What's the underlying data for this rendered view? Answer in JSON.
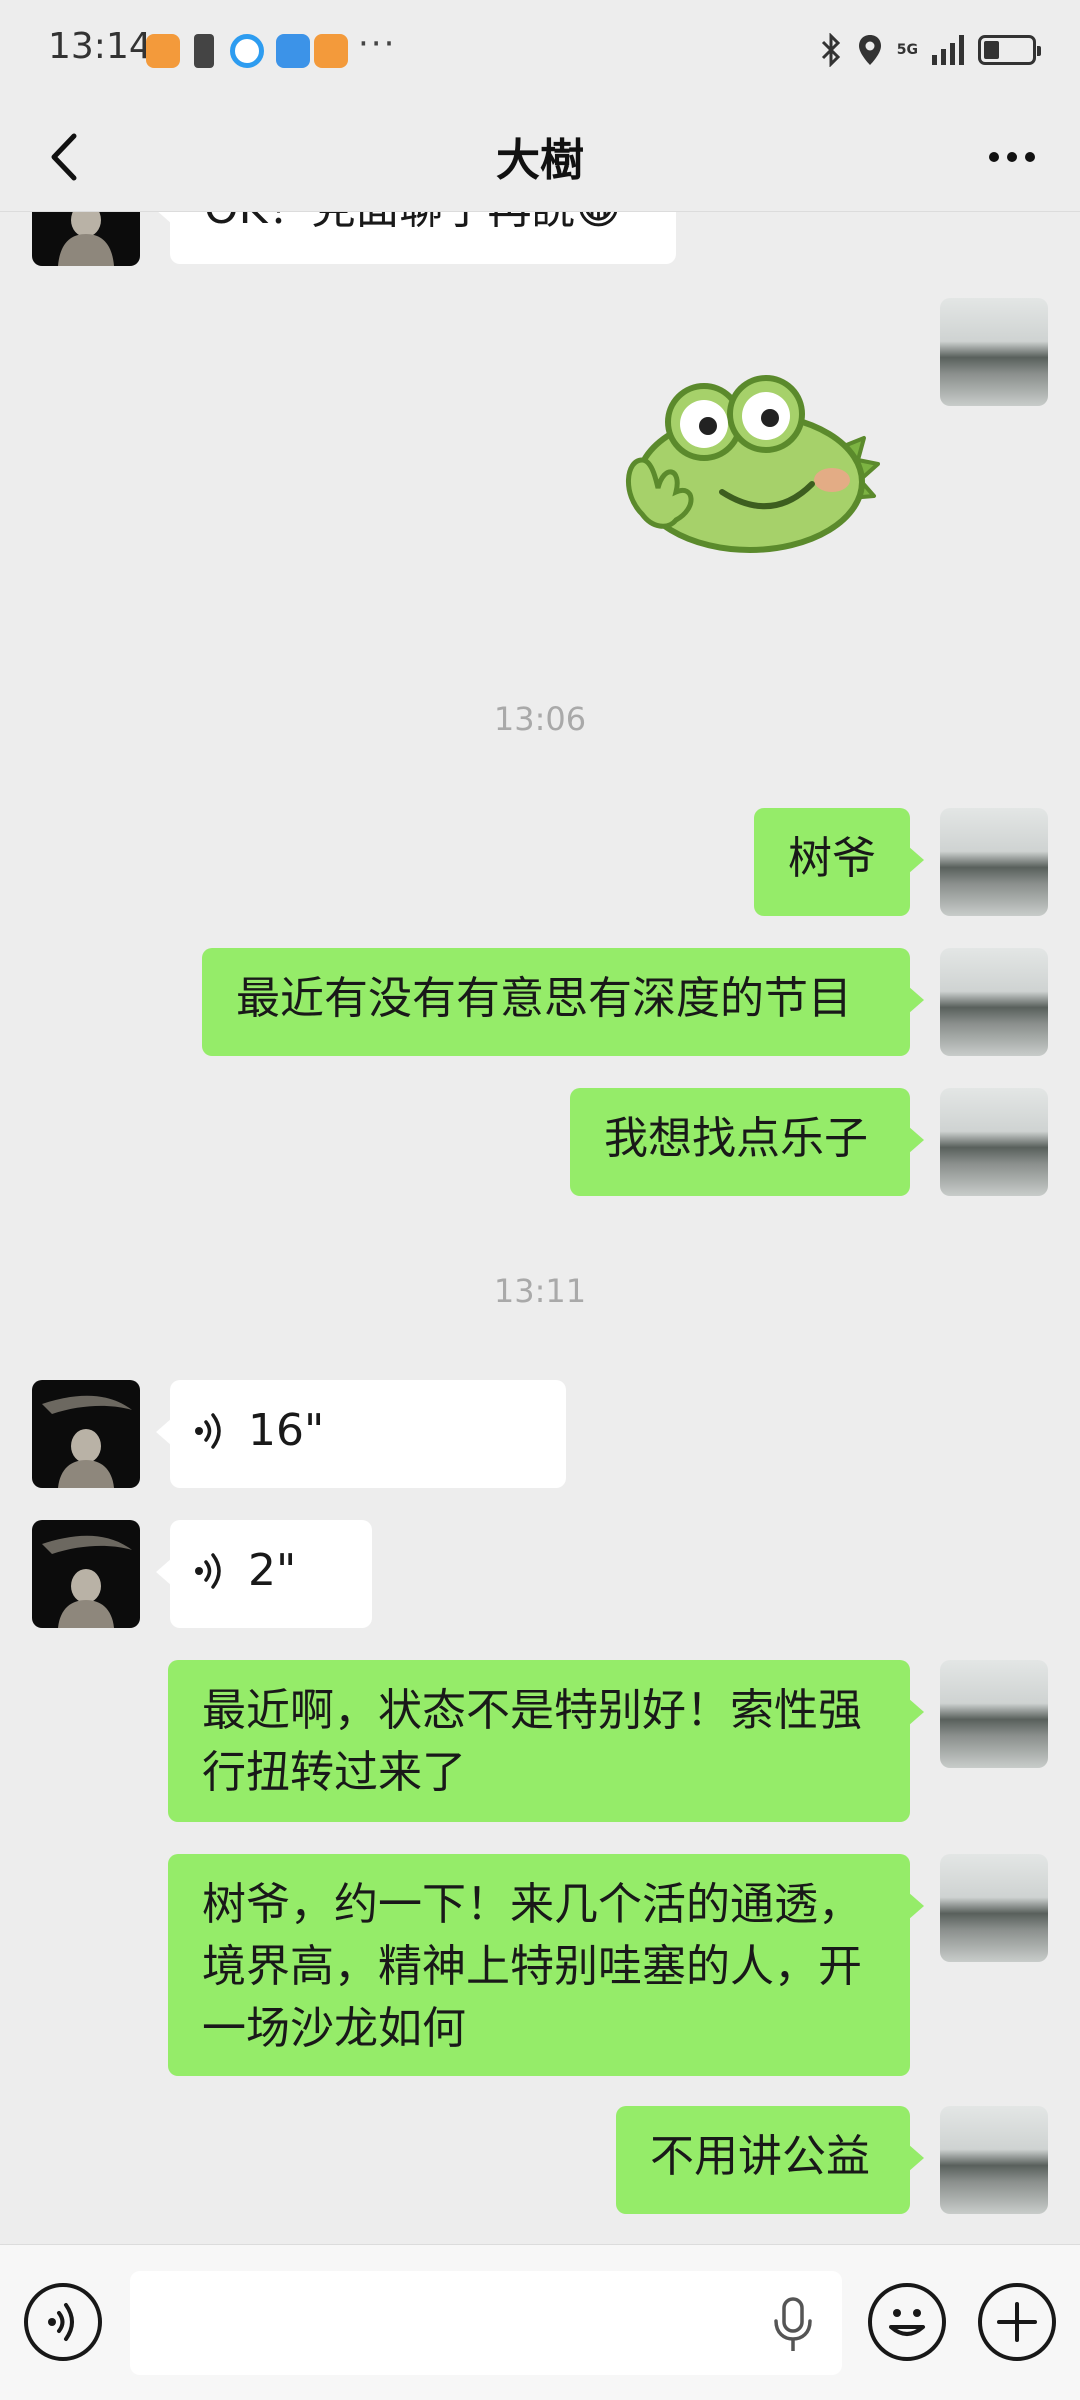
{
  "status_bar": {
    "time": "13:14",
    "more_notifications": "···",
    "network_label": "5G",
    "battery_level": 0.4
  },
  "header": {
    "title": "大樹",
    "back_icon": "chevron-left-icon",
    "more_icon": "more-horizontal-icon"
  },
  "messages": [
    {
      "side": "in",
      "type": "text",
      "text": "OK！見面聊了再說😁"
    },
    {
      "side": "out",
      "type": "sticker",
      "description": "green-frog-sticker"
    },
    {
      "type": "time",
      "text": "13:06"
    },
    {
      "side": "out",
      "type": "text",
      "text": "树爷"
    },
    {
      "side": "out",
      "type": "text",
      "text": "最近有没有有意思有深度的节目"
    },
    {
      "side": "out",
      "type": "text",
      "text": "我想找点乐子"
    },
    {
      "type": "time",
      "text": "13:11"
    },
    {
      "side": "in",
      "type": "voice",
      "duration": "16\""
    },
    {
      "side": "in",
      "type": "voice",
      "duration": "2\""
    },
    {
      "side": "out",
      "type": "text",
      "text": "最近啊，状态不是特别好！索性强行扭转过来了"
    },
    {
      "side": "out",
      "type": "text",
      "text": "树爷，约一下！来几个活的通透，境界高，精神上特别哇塞的人，开一场沙龙如何"
    },
    {
      "side": "out",
      "type": "text",
      "text": "不用讲公益"
    }
  ],
  "input_bar": {
    "voice_toggle_icon": "voice-mode-icon",
    "mic_icon": "microphone-icon",
    "emoji_icon": "emoji-icon",
    "add_icon": "plus-circle-icon",
    "input_value": "",
    "input_placeholder": ""
  },
  "colors": {
    "background": "#ededed",
    "outgoing_bubble": "#95ec69",
    "incoming_bubble": "#ffffff",
    "timestamp": "#a9a9a9"
  }
}
